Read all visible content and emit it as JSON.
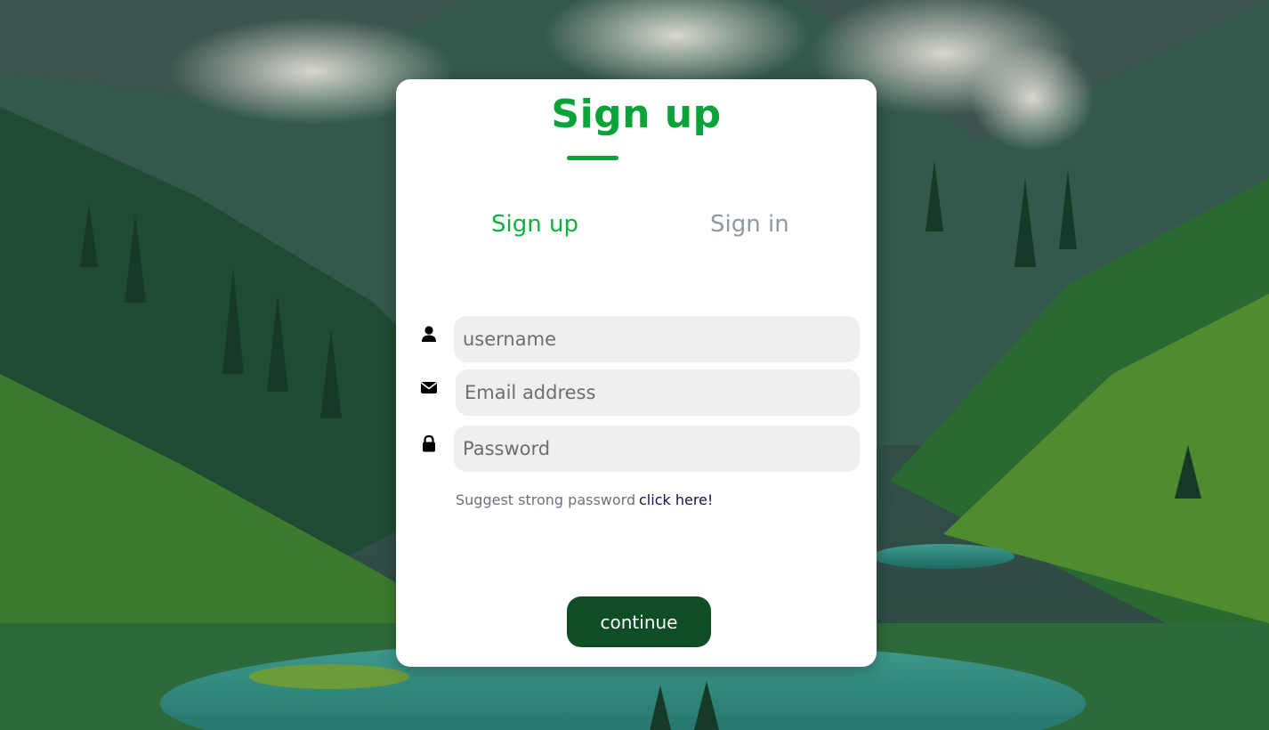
{
  "card": {
    "title": "Sign up"
  },
  "tabs": [
    {
      "label": "Sign up",
      "active": true
    },
    {
      "label": "Sign in",
      "active": false
    }
  ],
  "form": {
    "username": {
      "icon": "user-icon",
      "placeholder": "username",
      "value": ""
    },
    "email": {
      "icon": "envelope-icon",
      "placeholder": "Email address",
      "value": ""
    },
    "password": {
      "icon": "lock-icon",
      "placeholder": "Password",
      "value": ""
    }
  },
  "hint": {
    "text": "Suggest strong password",
    "link_text": "click here!"
  },
  "actions": {
    "continue_label": "continue"
  },
  "colors": {
    "accent_green": "#0aa33a",
    "inactive_tab": "#8f98a3",
    "button_bg": "#0f4d24",
    "input_bg": "#efefef",
    "link": "#11124a"
  }
}
